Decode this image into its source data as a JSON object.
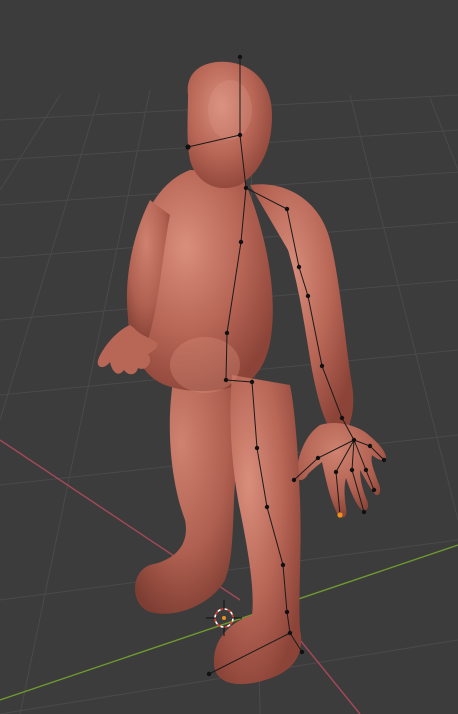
{
  "viewport": {
    "background_color": "#3c3c3c",
    "grid_color": "#4a4a4a",
    "x_axis_color": "#a4485a",
    "y_axis_color": "#6f9a2e",
    "mesh_color": "#b86656",
    "mesh_shadow_color": "#8c4438",
    "mesh_highlight_color": "#d98e7c",
    "rig_line_color": "#1a1a1a",
    "rig_joint_color": "#111111",
    "active_joint_color": "#f0901a",
    "cursor_ring_color": "#ffffff",
    "cursor_accent_color": "#e0402a"
  },
  "objects": {
    "mesh": "character-mesh",
    "armature": "rig-skeleton",
    "cursor": "3d-cursor"
  }
}
